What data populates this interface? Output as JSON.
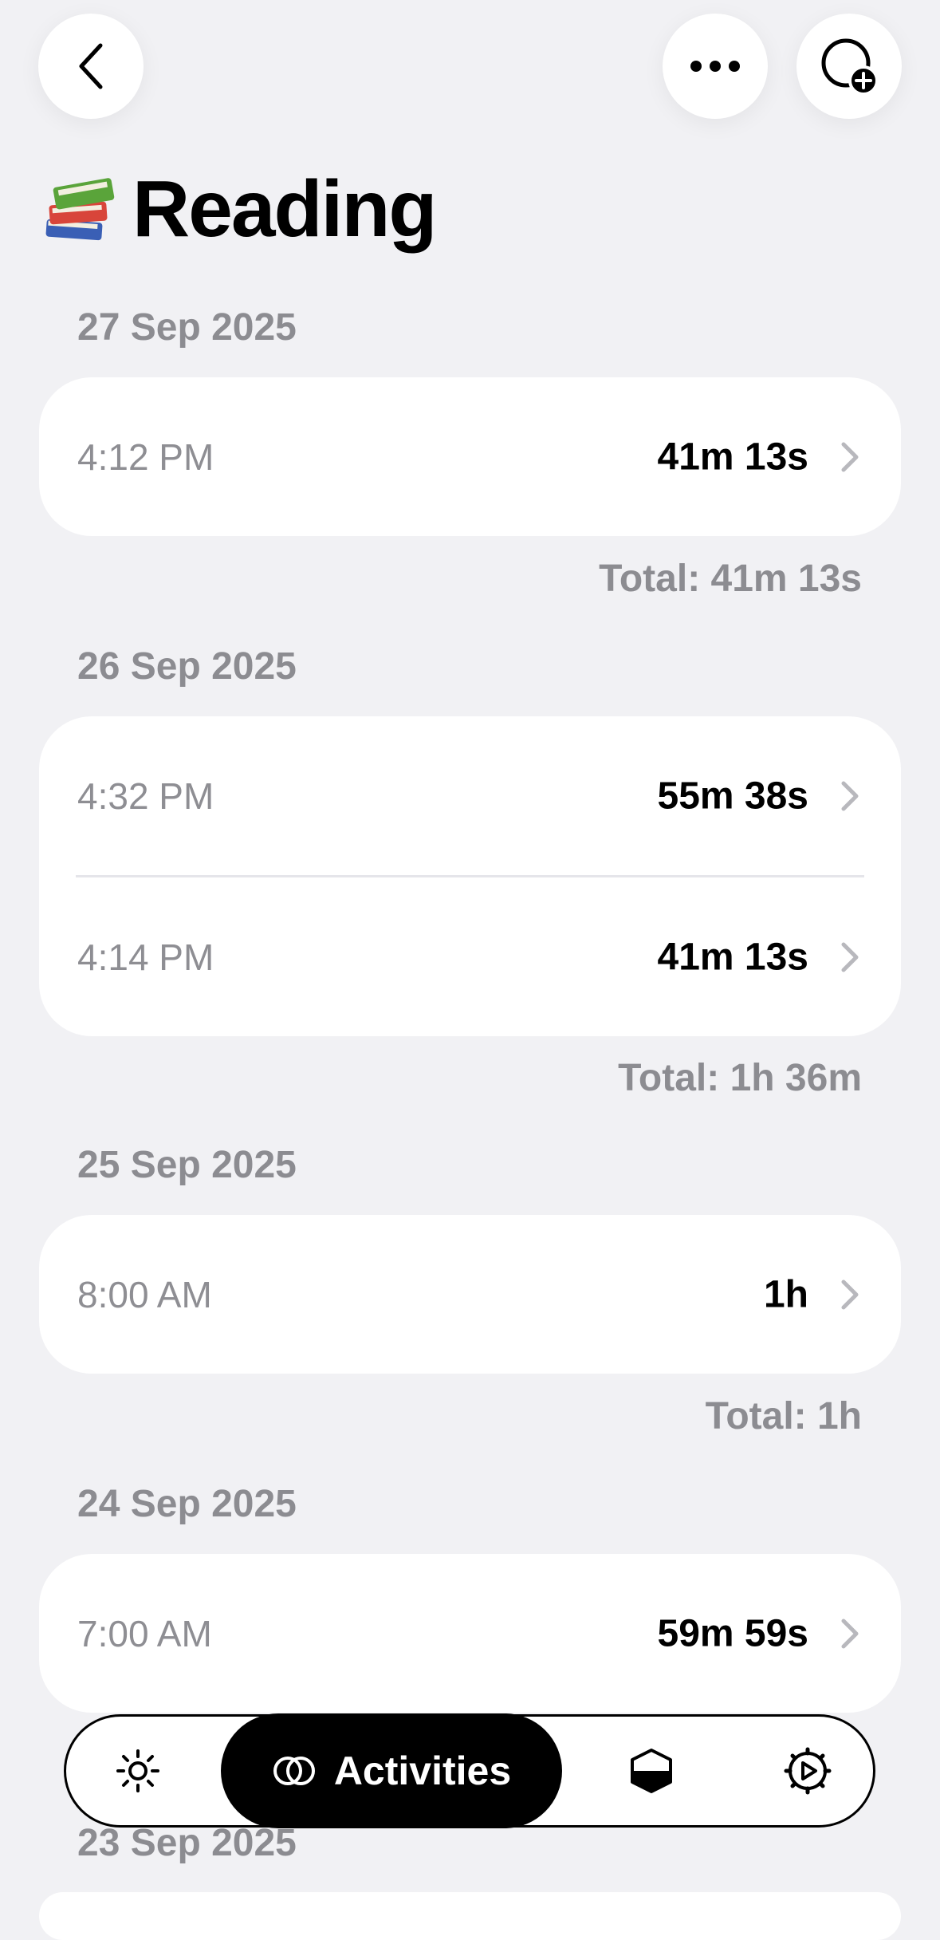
{
  "header": {
    "title": "Reading",
    "title_emoji": "books-emoji",
    "back_icon": "chevron-left-icon",
    "more_icon": "ellipsis-icon",
    "add_icon": "add-circle-icon"
  },
  "days": [
    {
      "date": "27 Sep 2025",
      "entries": [
        {
          "time": "4:12 PM",
          "duration": "41m 13s"
        }
      ],
      "total": "Total: 41m 13s"
    },
    {
      "date": "26 Sep 2025",
      "entries": [
        {
          "time": "4:32 PM",
          "duration": "55m 38s"
        },
        {
          "time": "4:14 PM",
          "duration": "41m 13s"
        }
      ],
      "total": "Total: 1h 36m"
    },
    {
      "date": "25 Sep 2025",
      "entries": [
        {
          "time": "8:00 AM",
          "duration": "1h"
        }
      ],
      "total": "Total: 1h"
    },
    {
      "date": "24 Sep 2025",
      "entries": [
        {
          "time": "7:00 AM",
          "duration": "59m 59s"
        }
      ]
    },
    {
      "date": "23 Sep 2025"
    }
  ],
  "tabbar": {
    "activities_label": "Activities",
    "tabs": [
      "brightness-icon",
      "activities-icon",
      "half-shape-icon",
      "gear-icon"
    ]
  },
  "colors": {
    "background": "#f1f1f4",
    "card": "#ffffff",
    "secondary_text": "#8e8e93",
    "accent": "#000000"
  }
}
